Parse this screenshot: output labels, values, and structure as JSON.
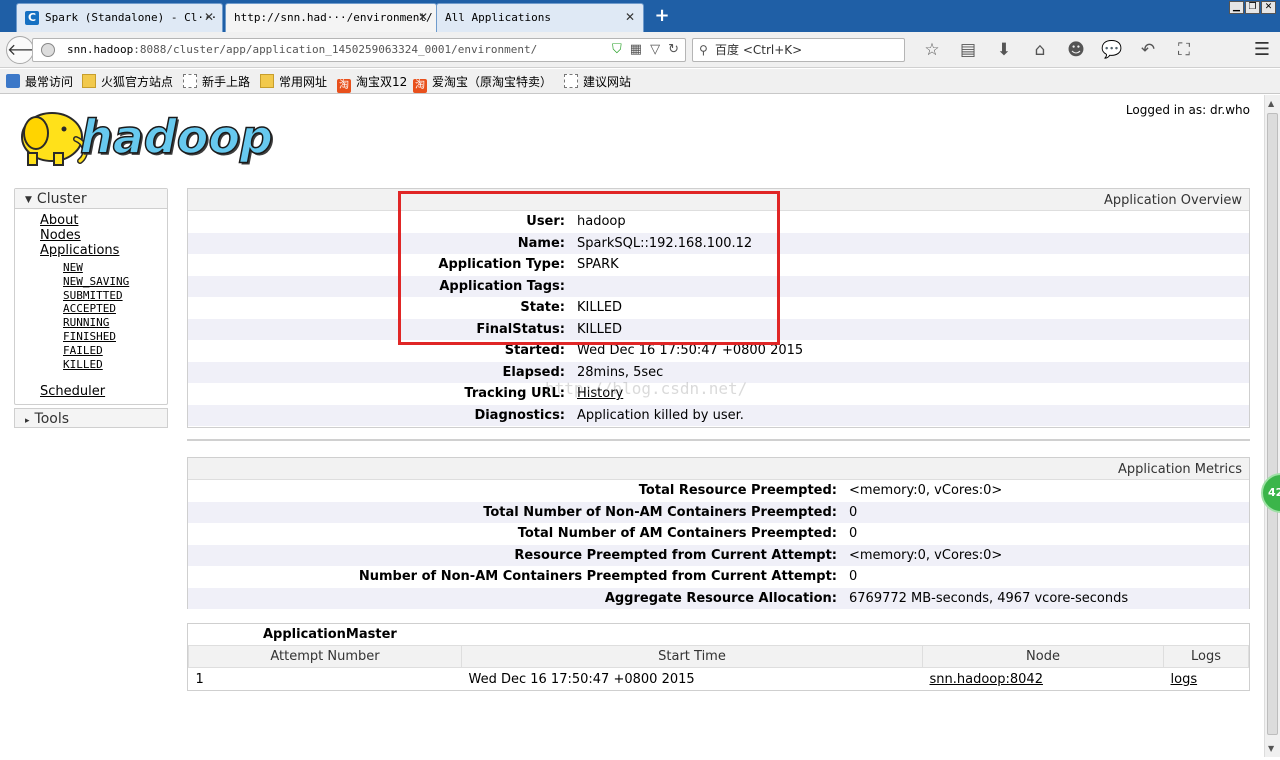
{
  "browser": {
    "tabs": [
      {
        "title": "Spark (Standalone) - Cl···",
        "favicon_letter": "C",
        "active": false
      },
      {
        "title": "http://snn.had···/environment/",
        "active": true
      },
      {
        "title": "All Applications",
        "active": false
      }
    ],
    "new_tab": "+",
    "url_host": "snn.hadoop",
    "url_rest": ":8088/cluster/app/application_1450259063324_0001/environment/",
    "search_placeholder": "百度 <Ctrl+K>",
    "bookmarks": [
      {
        "label": "最常访问",
        "icon": "star"
      },
      {
        "label": "火狐官方站点",
        "icon": "folder"
      },
      {
        "label": "新手上路",
        "icon": "dotted"
      },
      {
        "label": "常用网址",
        "icon": "folder"
      },
      {
        "label": "淘宝双12",
        "icon": "taobao"
      },
      {
        "label": "爱淘宝（原淘宝特卖）",
        "icon": "taobao"
      },
      {
        "label": "建议网站",
        "icon": "dotted"
      }
    ],
    "taobao_glyph": "淘",
    "green_badge": "42"
  },
  "header": {
    "logo_text": "hadoop",
    "logged_in": "Logged in as: dr.who"
  },
  "nav": {
    "cluster_label": "Cluster",
    "items": [
      "About",
      "Nodes",
      "Applications"
    ],
    "app_states": [
      "NEW",
      "NEW_SAVING",
      "SUBMITTED",
      "ACCEPTED",
      "RUNNING",
      "FINISHED",
      "FAILED",
      "KILLED"
    ],
    "scheduler": "Scheduler",
    "tools_label": "Tools"
  },
  "overview": {
    "title": "Application Overview",
    "rows": [
      {
        "key": "User:",
        "value": "hadoop"
      },
      {
        "key": "Name:",
        "value": "SparkSQL::192.168.100.12"
      },
      {
        "key": "Application Type:",
        "value": "SPARK"
      },
      {
        "key": "Application Tags:",
        "value": ""
      },
      {
        "key": "State:",
        "value": "KILLED"
      },
      {
        "key": "FinalStatus:",
        "value": "KILLED"
      },
      {
        "key": "Started:",
        "value": "Wed Dec 16 17:50:47 +0800 2015"
      },
      {
        "key": "Elapsed:",
        "value": "28mins, 5sec"
      },
      {
        "key": "Tracking URL:",
        "value": "History"
      },
      {
        "key": "Diagnostics:",
        "value": "Application killed by user."
      }
    ]
  },
  "metrics": {
    "title": "Application Metrics",
    "rows": [
      {
        "key": "Total Resource Preempted:",
        "value": "<memory:0, vCores:0>"
      },
      {
        "key": "Total Number of Non-AM Containers Preempted:",
        "value": "0"
      },
      {
        "key": "Total Number of AM Containers Preempted:",
        "value": "0"
      },
      {
        "key": "Resource Preempted from Current Attempt:",
        "value": "<memory:0, vCores:0>"
      },
      {
        "key": "Number of Non-AM Containers Preempted from Current Attempt:",
        "value": "0"
      },
      {
        "key": "Aggregate Resource Allocation:",
        "value": "6769772 MB-seconds, 4967 vcore-seconds"
      }
    ]
  },
  "app_master": {
    "title": "ApplicationMaster",
    "columns": [
      "Attempt Number",
      "Start Time",
      "Node",
      "Logs"
    ],
    "rows": [
      {
        "attempt": "1",
        "start": "Wed Dec 16 17:50:47 +0800 2015",
        "node": "snn.hadoop:8042",
        "logs": "logs"
      }
    ]
  },
  "watermark": "http://blog.csdn.net/"
}
